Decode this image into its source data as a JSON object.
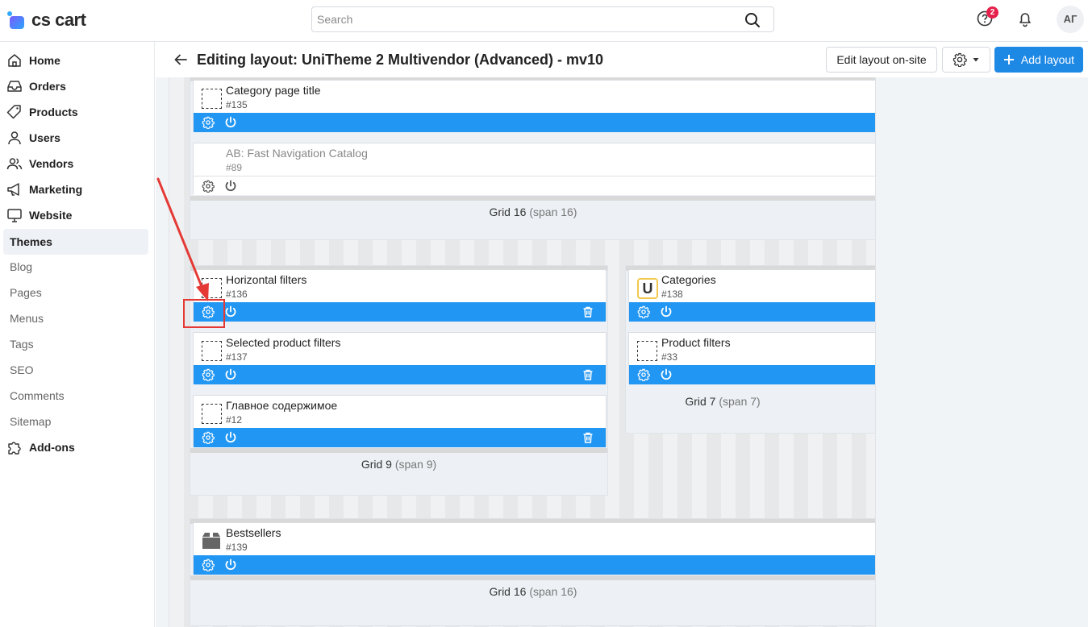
{
  "app": {
    "logo_text": "cs cart"
  },
  "search": {
    "placeholder": "Search"
  },
  "notifications": {
    "badge_count": "2"
  },
  "user": {
    "initials": "АГ"
  },
  "sidebar": {
    "items": [
      {
        "label": "Home",
        "icon": "home-icon"
      },
      {
        "label": "Orders",
        "icon": "inbox-icon"
      },
      {
        "label": "Products",
        "icon": "tag-icon"
      },
      {
        "label": "Users",
        "icon": "user-icon"
      },
      {
        "label": "Vendors",
        "icon": "users-icon"
      },
      {
        "label": "Marketing",
        "icon": "megaphone-icon"
      },
      {
        "label": "Website",
        "icon": "monitor-icon"
      },
      {
        "label": "Themes"
      },
      {
        "label": "Blog"
      },
      {
        "label": "Pages"
      },
      {
        "label": "Menus"
      },
      {
        "label": "Tags"
      },
      {
        "label": "SEO"
      },
      {
        "label": "Comments"
      },
      {
        "label": "Sitemap"
      },
      {
        "label": "Add-ons",
        "icon": "puzzle-icon"
      }
    ]
  },
  "header": {
    "title": "Editing layout: UniTheme 2 Multivendor (Advanced) - mv10",
    "edit_onsite_label": "Edit layout on-site",
    "add_layout_label": "Add layout"
  },
  "layout": {
    "grids": {
      "top": {
        "name": "Grid 16",
        "span": "(span 16)"
      },
      "left": {
        "name": "Grid 9",
        "span": "(span 9)"
      },
      "right": {
        "name": "Grid 7",
        "span": "(span 7)"
      },
      "bottom": {
        "name": "Grid 16",
        "span": "(span 16)"
      }
    },
    "blocks": {
      "category_title": {
        "title": "Category page title",
        "id": "#135"
      },
      "fast_nav": {
        "title": "AB: Fast Navigation Catalog",
        "id": "#89"
      },
      "horizontal_filters": {
        "title": "Horizontal filters",
        "id": "#136"
      },
      "selected_filters": {
        "title": "Selected product filters",
        "id": "#137"
      },
      "main_content": {
        "title": "Главное содержимое",
        "id": "#12"
      },
      "categories": {
        "title": "Categories",
        "id": "#138",
        "icon_letter": "U"
      },
      "product_filters": {
        "title": "Product filters",
        "id": "#33"
      },
      "bestsellers": {
        "title": "Bestsellers",
        "id": "#139"
      }
    }
  },
  "colors": {
    "accent": "#2196f3",
    "primary_button": "#1e88e5",
    "annotation": "#e53935",
    "badge": "#e5204a"
  }
}
